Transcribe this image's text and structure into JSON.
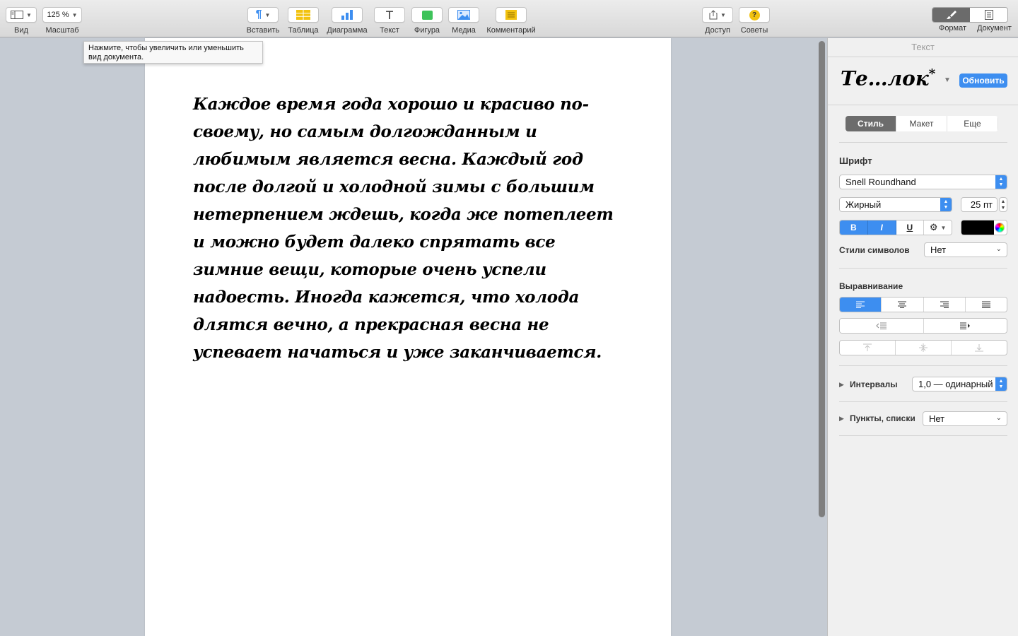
{
  "toolbar": {
    "view_label": "Вид",
    "zoom_value": "125 %",
    "zoom_label": "Масштаб",
    "insert_label": "Вставить",
    "table_label": "Таблица",
    "chart_label": "Диаграмма",
    "text_label": "Текст",
    "shape_label": "Фигура",
    "media_label": "Медиа",
    "comment_label": "Комментарий",
    "share_label": "Доступ",
    "tips_label": "Советы",
    "format_label": "Формат",
    "document_label": "Документ",
    "accent_yellow": "#f7d82b",
    "accent_green": "#3ec35a",
    "accent_blue": "#3d8ef0"
  },
  "tooltip": {
    "text": "Нажмите, чтобы увеличить или уменьшить вид документа."
  },
  "document": {
    "body": "Каждое время года хорошо и красиво по-своему, но самым долгожданным и любимым является весна. Каждый год после долгой и холодной зимы с большим нетерпением ждешь, когда же потеплеет и можно будет далеко спрятать все зимние вещи, которые очень успели надоесть. Иногда кажется, что холода длятся вечно, а прекрасная весна не успевает начаться и уже заканчивается."
  },
  "inspector": {
    "title": "Текст",
    "style_preview": "Те…лок",
    "style_modified_mark": "*",
    "update_button": "Обновить",
    "tabs": [
      "Стиль",
      "Макет",
      "Еще"
    ],
    "font_section": "Шрифт",
    "font_name": "Snell Roundhand",
    "font_weight": "Жирный",
    "font_size": "25 пт",
    "bold_label": "B",
    "italic_label": "I",
    "underline_label": "U",
    "text_color": "#000000",
    "char_styles_label": "Стили символов",
    "char_styles_value": "Нет",
    "alignment_section": "Выравнивание",
    "spacing_label": "Интервалы",
    "spacing_value": "1,0 — одинарный",
    "bullets_label": "Пункты, списки",
    "bullets_value": "Нет"
  }
}
